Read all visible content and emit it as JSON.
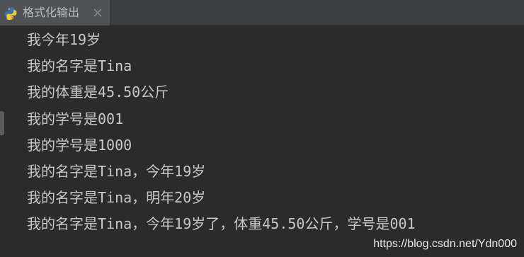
{
  "tab": {
    "title": "格式化输出",
    "icon": "python-file-icon",
    "close_icon": "close-icon"
  },
  "console": {
    "lines": [
      "我今年19岁",
      "我的名字是Tina",
      "我的体重是45.50公斤",
      "我的学号是001",
      "我的学号是1000",
      "我的名字是Tina，今年19岁",
      "我的名字是Tina，明年20岁",
      "我的名字是Tina，今年19岁了，体重45.50公斤，学号是001"
    ]
  },
  "watermark": "https://blog.csdn.net/Ydn000",
  "colors": {
    "background": "#2b2b2b",
    "tab_bar": "#3c3f41",
    "active_tab": "#4e5254",
    "text": "#c8c8c8",
    "python_blue": "#3a74a9",
    "python_yellow": "#f2c83c"
  }
}
